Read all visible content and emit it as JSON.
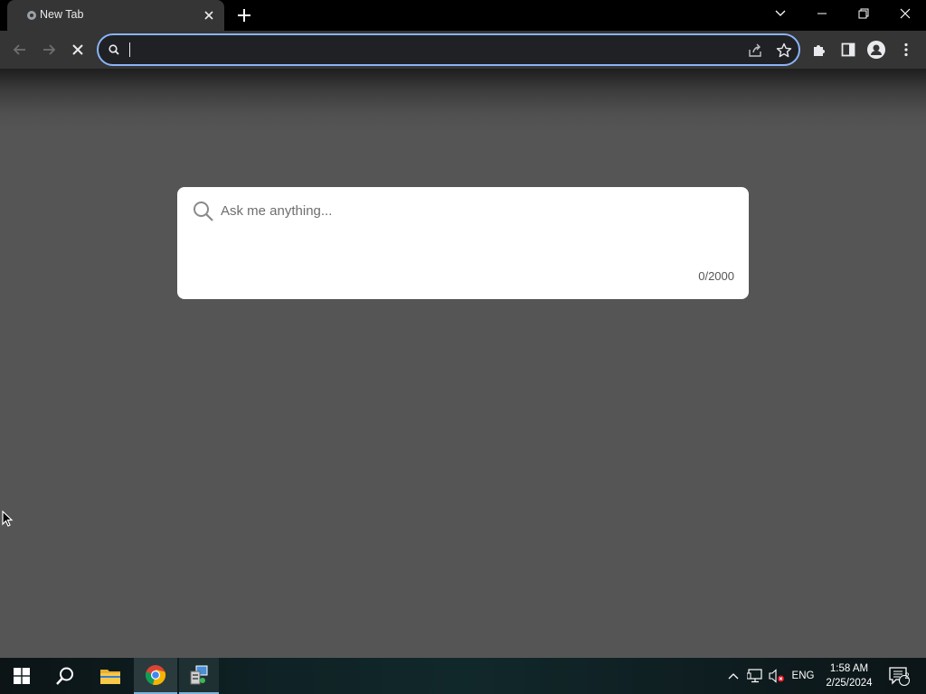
{
  "tab": {
    "title": "New Tab"
  },
  "omnibox": {
    "value": "",
    "placeholder": ""
  },
  "ask": {
    "placeholder": "Ask me anything...",
    "counter": "0/2000"
  },
  "tray": {
    "language": "ENG",
    "time": "1:58 AM",
    "date": "2/25/2024",
    "notification_count": "2"
  },
  "colors": {
    "accent": "#8ab4f8",
    "toolbar": "#353535",
    "page": "#555555",
    "card": "#ffffff"
  },
  "icons": [
    "globe-icon",
    "close-icon",
    "plus-icon",
    "chevron-down-icon",
    "minimize-icon",
    "restore-icon",
    "back-arrow-icon",
    "forward-arrow-icon",
    "stop-icon",
    "search-icon",
    "share-icon",
    "star-icon",
    "puzzle-icon",
    "side-panel-icon",
    "profile-icon",
    "kebab-menu-icon",
    "windows-logo-icon",
    "file-explorer-icon",
    "chrome-icon",
    "app-icon",
    "chevron-up-icon",
    "network-icon",
    "speaker-muted-icon",
    "notification-icon"
  ]
}
